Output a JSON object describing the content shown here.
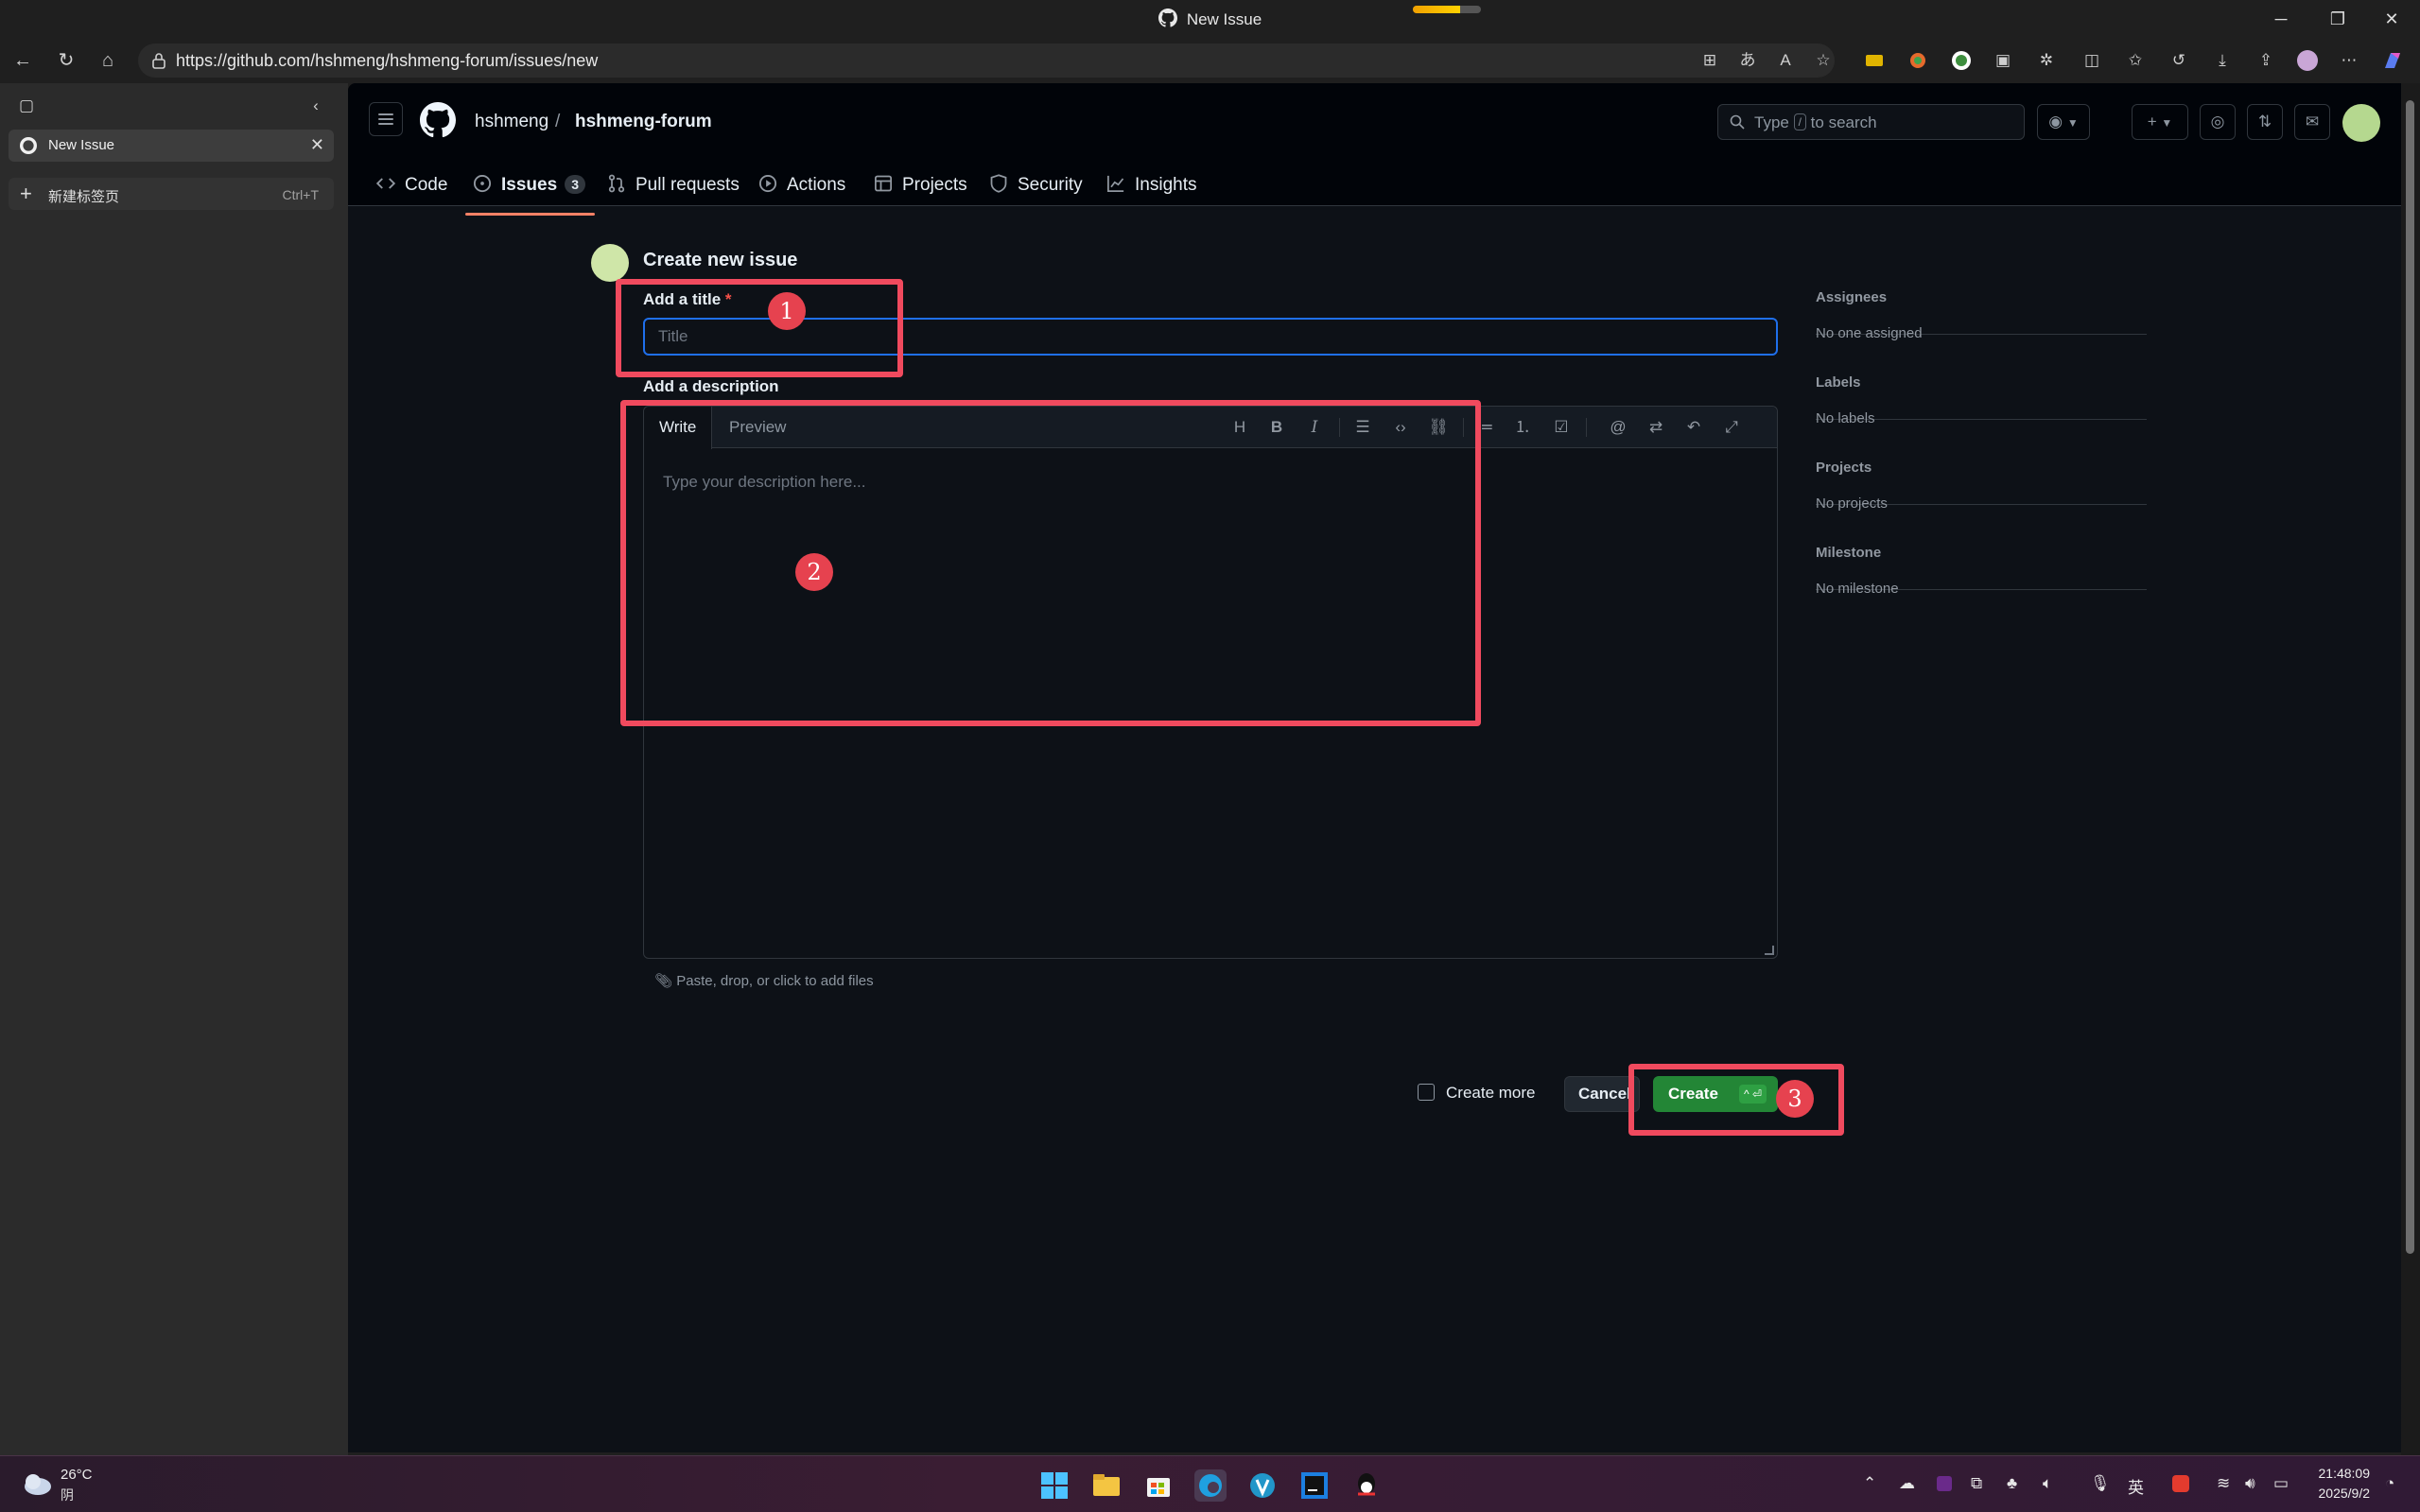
{
  "window": {
    "title": "New Issue"
  },
  "browser": {
    "url": "https://github.com/hshmeng/hshmeng-forum/issues/new",
    "tabs": [
      {
        "label": "New Issue"
      },
      {
        "label": "新建标签页",
        "shortcut": "Ctrl+T"
      }
    ]
  },
  "github": {
    "owner": "hshmeng",
    "separator": "/",
    "repo": "hshmeng-forum",
    "search": {
      "prefix": "Type",
      "key": "/",
      "suffix": "to search"
    },
    "nav": [
      {
        "label": "Code",
        "icon": "code-icon"
      },
      {
        "label": "Issues",
        "icon": "issue-opened-icon",
        "count": "3",
        "active": true
      },
      {
        "label": "Pull requests",
        "icon": "git-pull-request-icon"
      },
      {
        "label": "Actions",
        "icon": "play-icon"
      },
      {
        "label": "Projects",
        "icon": "table-icon"
      },
      {
        "label": "Security",
        "icon": "shield-icon"
      },
      {
        "label": "Insights",
        "icon": "graph-icon"
      }
    ]
  },
  "form": {
    "heading": "Create new issue",
    "title_label": "Add a title",
    "required_mark": "*",
    "title_placeholder": "Title",
    "title_value": "",
    "description_label": "Add a description",
    "tab_write": "Write",
    "tab_preview": "Preview",
    "description_placeholder": "Type your description here...",
    "attach_hint": "Paste, drop, or click to add files",
    "create_more_label": "Create more",
    "create_more_checked": false,
    "cancel_label": "Cancel",
    "create_label": "Create",
    "create_shortcut": "^ ⏎"
  },
  "sidebar": {
    "assignees": {
      "heading": "Assignees",
      "value": "No one assigned"
    },
    "labels": {
      "heading": "Labels",
      "value": "No labels"
    },
    "projects": {
      "heading": "Projects",
      "value": "No projects"
    },
    "milestone": {
      "heading": "Milestone",
      "value": "No milestone"
    }
  },
  "annotations": {
    "title_box": "1",
    "description_box": "2",
    "create_box": "3",
    "color": "#f04a5e"
  },
  "taskbar": {
    "weather_temp": "26°C",
    "weather_desc": "阴",
    "ime": "英",
    "time": "21:48:09",
    "date": "2025/9/2"
  },
  "colors": {
    "page_bg": "#0d1117",
    "header_bg": "#010409",
    "accent_blue": "#1f6feb",
    "create_green": "#238636",
    "active_tab_underline": "#f78166"
  }
}
